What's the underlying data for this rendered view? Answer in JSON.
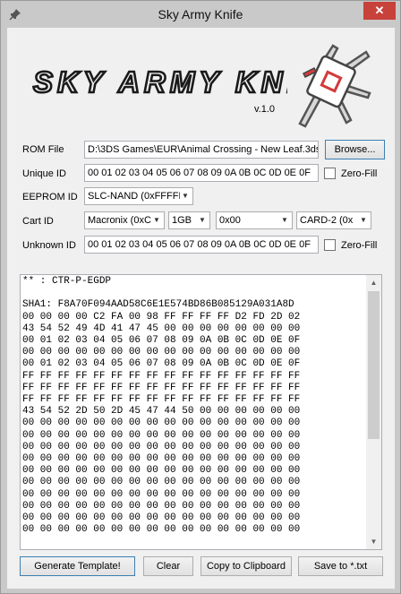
{
  "window": {
    "title": "Sky Army Knife",
    "close_symbol": "✕",
    "icon": "pin-icon"
  },
  "header": {
    "logo_text": "SKY ARMY KNIFE",
    "version": "v.1.0",
    "logo_image": "swiss-army-knife-icon"
  },
  "form": {
    "rom_file": {
      "label": "ROM File",
      "value": "D:\\3DS Games\\EUR\\Animal Crossing - New Leaf.3ds",
      "browse_label": "Browse..."
    },
    "unique_id": {
      "label": "Unique ID",
      "value": "00 01 02 03 04 05 06 07 08 09 0A 0B 0C 0D 0E 0F",
      "zero_fill_label": "Zero-Fill",
      "zero_fill_checked": false
    },
    "eeprom_id": {
      "label": "EEPROM ID",
      "value": "SLC-NAND (0xFFFFF"
    },
    "cart_id": {
      "label": "Cart ID",
      "manufacturer": "Macronix (0xC",
      "size": "1GB",
      "value": "0x00",
      "card_type": "CARD-2 (0x"
    },
    "unknown_id": {
      "label": "Unknown ID",
      "value": "00 01 02 03 04 05 06 07 08 09 0A 0B 0C 0D 0E 0F",
      "zero_fill_label": "Zero-Fill",
      "zero_fill_checked": false
    }
  },
  "output": {
    "lines": [
      "** : CTR-P-EGDP",
      "",
      "SHA1: F8A70F094AAD58C6E1E574BD86B085129A031A8D",
      "00 00 00 00 C2 FA 00 98 FF FF FF FF D2 FD 2D 02",
      "43 54 52 49 4D 41 47 45 00 00 00 00 00 00 00 00",
      "00 01 02 03 04 05 06 07 08 09 0A 0B 0C 0D 0E 0F",
      "00 00 00 00 00 00 00 00 00 00 00 00 00 00 00 00",
      "00 01 02 03 04 05 06 07 08 09 0A 0B 0C 0D 0E 0F",
      "FF FF FF FF FF FF FF FF FF FF FF FF FF FF FF FF",
      "FF FF FF FF FF FF FF FF FF FF FF FF FF FF FF FF",
      "FF FF FF FF FF FF FF FF FF FF FF FF FF FF FF FF",
      "43 54 52 2D 50 2D 45 47 44 50 00 00 00 00 00 00",
      "00 00 00 00 00 00 00 00 00 00 00 00 00 00 00 00",
      "00 00 00 00 00 00 00 00 00 00 00 00 00 00 00 00",
      "00 00 00 00 00 00 00 00 00 00 00 00 00 00 00 00",
      "00 00 00 00 00 00 00 00 00 00 00 00 00 00 00 00",
      "00 00 00 00 00 00 00 00 00 00 00 00 00 00 00 00",
      "00 00 00 00 00 00 00 00 00 00 00 00 00 00 00 00",
      "00 00 00 00 00 00 00 00 00 00 00 00 00 00 00 00",
      "00 00 00 00 00 00 00 00 00 00 00 00 00 00 00 00",
      "00 00 00 00 00 00 00 00 00 00 00 00 00 00 00 00",
      "00 00 00 00 00 00 00 00 00 00 00 00 00 00 00 00"
    ]
  },
  "buttons": {
    "generate": "Generate Template!",
    "clear": "Clear",
    "copy": "Copy to Clipboard",
    "save": "Save to *.txt"
  },
  "colors": {
    "close_button": "#c7423a",
    "titlebar": "#c9c9c9",
    "client_bg": "#f0f0f0",
    "accent_border": "#3c7fb1"
  }
}
